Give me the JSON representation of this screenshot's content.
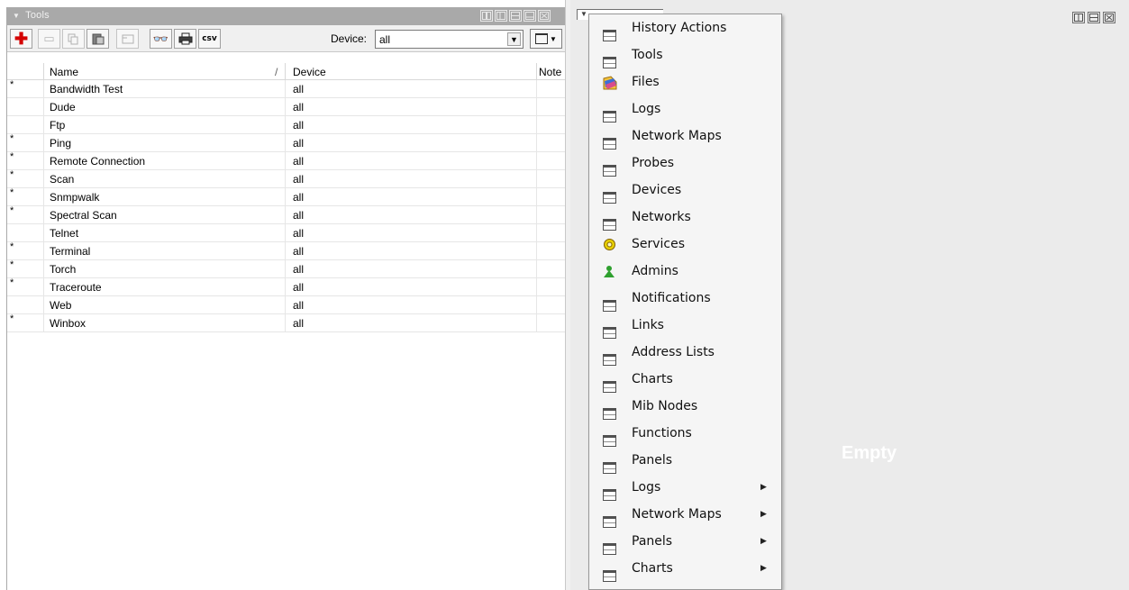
{
  "left_panel": {
    "title": "Tools",
    "toolbar": {
      "device_label": "Device:",
      "device_value": "all",
      "csv_label": "csv"
    },
    "columns": {
      "name": "Name",
      "sort_mark": "/",
      "device": "Device",
      "note": "Note"
    },
    "rows": [
      {
        "flag": "*",
        "name": "Bandwidth Test",
        "device": "all"
      },
      {
        "flag": "",
        "name": "Dude",
        "device": "all"
      },
      {
        "flag": "",
        "name": "Ftp",
        "device": "all"
      },
      {
        "flag": "*",
        "name": "Ping",
        "device": "all"
      },
      {
        "flag": "*",
        "name": "Remote Connection",
        "device": "all"
      },
      {
        "flag": "*",
        "name": "Scan",
        "device": "all"
      },
      {
        "flag": "*",
        "name": "Snmpwalk",
        "device": "all"
      },
      {
        "flag": "*",
        "name": "Spectral Scan",
        "device": "all"
      },
      {
        "flag": "",
        "name": "Telnet",
        "device": "all"
      },
      {
        "flag": "*",
        "name": "Terminal",
        "device": "all"
      },
      {
        "flag": "*",
        "name": "Torch",
        "device": "all"
      },
      {
        "flag": "*",
        "name": "Traceroute",
        "device": "all"
      },
      {
        "flag": "",
        "name": "Web",
        "device": "all"
      },
      {
        "flag": "*",
        "name": "Winbox",
        "device": "all"
      }
    ]
  },
  "right_panel": {
    "empty_label": "Empty"
  },
  "context_menu": {
    "items": [
      {
        "label": "History Actions",
        "icon": "table-icon",
        "submenu": false
      },
      {
        "label": "Tools",
        "icon": "table-icon",
        "submenu": false
      },
      {
        "label": "Files",
        "icon": "files-icon",
        "submenu": false
      },
      {
        "label": "Logs",
        "icon": "table-icon",
        "submenu": false
      },
      {
        "label": "Network Maps",
        "icon": "table-icon",
        "submenu": false
      },
      {
        "label": "Probes",
        "icon": "table-icon",
        "submenu": false
      },
      {
        "label": "Devices",
        "icon": "table-icon",
        "submenu": false
      },
      {
        "label": "Networks",
        "icon": "table-icon",
        "submenu": false
      },
      {
        "label": "Services",
        "icon": "services-gear-icon",
        "submenu": false
      },
      {
        "label": "Admins",
        "icon": "admin-person-icon",
        "submenu": false
      },
      {
        "label": "Notifications",
        "icon": "table-icon",
        "submenu": false
      },
      {
        "label": "Links",
        "icon": "table-icon",
        "submenu": false
      },
      {
        "label": "Address Lists",
        "icon": "table-icon",
        "submenu": false
      },
      {
        "label": "Charts",
        "icon": "table-icon",
        "submenu": false
      },
      {
        "label": "Mib Nodes",
        "icon": "table-icon",
        "submenu": false
      },
      {
        "label": "Functions",
        "icon": "table-icon",
        "submenu": false
      },
      {
        "label": "Panels",
        "icon": "table-icon",
        "submenu": false
      },
      {
        "label": "Logs",
        "icon": "table-icon",
        "submenu": true
      },
      {
        "label": "Network Maps",
        "icon": "table-icon",
        "submenu": true
      },
      {
        "label": "Panels",
        "icon": "table-icon",
        "submenu": true
      },
      {
        "label": "Charts",
        "icon": "table-icon",
        "submenu": true
      }
    ],
    "submenu_arrow": "▶"
  },
  "colors": {
    "titlebar": "#a9a9a9",
    "add_red": "#d40000",
    "files_blue": "#3a6fd8",
    "services_yellow": "#e8d000",
    "admin_green": "#2fa02f"
  }
}
